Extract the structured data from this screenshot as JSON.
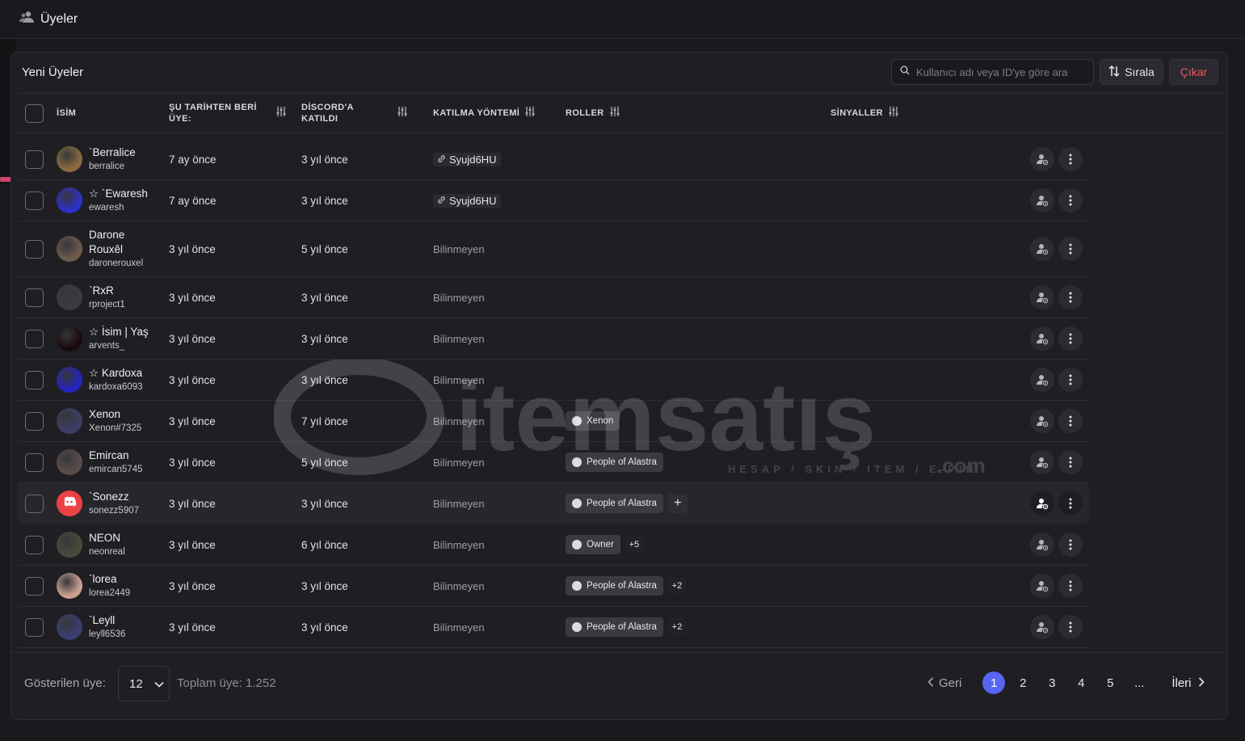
{
  "page": {
    "title": "Üyeler"
  },
  "panel": {
    "title": "Yeni Üyeler",
    "search_placeholder": "Kullanıcı adı veya ID'ye göre ara",
    "sort_label": "Sırala",
    "remove_label": "Çıkar"
  },
  "columns": {
    "name": "İSİM",
    "member_since": "ŞU TARİHTEN BERİ ÜYE:",
    "joined_discord": "DİSCORD'A KATILDI",
    "join_method": "KATILMA YÖNTEMİ",
    "roles": "ROLLER",
    "signals": "SİNYALLER"
  },
  "rows": [
    {
      "name": "`Berralice",
      "username": "berralice",
      "since": "7 ay önce",
      "joined": "3 yıl önce",
      "method": "Syujd6HU",
      "method_is_invite": true,
      "roles": [],
      "more": "",
      "avatar_color": "#8a6a3e"
    },
    {
      "name": "☆ `Ewaresh",
      "username": "ewaresh",
      "since": "7 ay önce",
      "joined": "3 yıl önce",
      "method": "Syujd6HU",
      "method_is_invite": true,
      "roles": [],
      "more": "",
      "avatar_color": "#2d30c8"
    },
    {
      "name": "Darone Rouxêl",
      "username": "daronerouxel",
      "since": "3 yıl önce",
      "joined": "5 yıl önce",
      "method": "Bilinmeyen",
      "method_is_invite": false,
      "roles": [],
      "more": "",
      "avatar_color": "#6d5a4c"
    },
    {
      "name": "`RxR",
      "username": "rproject1",
      "since": "3 yıl önce",
      "joined": "3 yıl önce",
      "method": "Bilinmeyen",
      "method_is_invite": false,
      "roles": [],
      "more": "",
      "avatar_color": "#3c3c40"
    },
    {
      "name": "☆ İsim | Yaş",
      "username": "arvents_",
      "since": "3 yıl önce",
      "joined": "3 yıl önce",
      "method": "Bilinmeyen",
      "method_is_invite": false,
      "roles": [],
      "more": "",
      "avatar_color": "#1b0a0c"
    },
    {
      "name": "☆ Kardoxa",
      "username": "kardoxa6093",
      "since": "3 yıl önce",
      "joined": "3 yıl önce",
      "method": "Bilinmeyen",
      "method_is_invite": false,
      "roles": [],
      "more": "",
      "avatar_color": "#2424c0"
    },
    {
      "name": "Xenon",
      "username": "Xenon#7325",
      "since": "3 yıl önce",
      "joined": "7 yıl önce",
      "method": "Bilinmeyen",
      "method_is_invite": false,
      "roles": [
        "Xenon"
      ],
      "more": "",
      "avatar_color": "#3d3d66"
    },
    {
      "name": "Emircan",
      "username": "emircan5745",
      "since": "3 yıl önce",
      "joined": "5 yıl önce",
      "method": "Bilinmeyen",
      "method_is_invite": false,
      "roles": [
        "People of Alastra"
      ],
      "more": "",
      "avatar_color": "#5a4c4a"
    },
    {
      "name": "`Sonezz",
      "username": "sonezz5907",
      "since": "3 yıl önce",
      "joined": "3 yıl önce",
      "method": "Bilinmeyen",
      "method_is_invite": false,
      "roles": [
        "People of Alastra"
      ],
      "more": "",
      "add_role": "+",
      "avatar_color": "#ed4245",
      "highlight": true
    },
    {
      "name": "NEON",
      "username": "neonreal",
      "since": "3 yıl önce",
      "joined": "6 yıl önce",
      "method": "Bilinmeyen",
      "method_is_invite": false,
      "roles": [
        "Owner"
      ],
      "more": "+5",
      "avatar_color": "#4a4a3a"
    },
    {
      "name": "`lorea",
      "username": "lorea2449",
      "since": "3 yıl önce",
      "joined": "3 yıl önce",
      "method": "Bilinmeyen",
      "method_is_invite": false,
      "roles": [
        "People of Alastra"
      ],
      "more": "+2",
      "avatar_color": "#c9a090"
    },
    {
      "name": "`Leyll",
      "username": "leyll6536",
      "since": "3 yıl önce",
      "joined": "3 yıl önce",
      "method": "Bilinmeyen",
      "method_is_invite": false,
      "roles": [
        "People of Alastra"
      ],
      "more": "+2",
      "avatar_color": "#3a3f70"
    }
  ],
  "footer": {
    "shown_label": "Gösterilen üye:",
    "page_size": "12",
    "total_label": "Toplam üye: 1.252",
    "prev_label": "Geri",
    "next_label": "İleri",
    "pages": [
      "1",
      "2",
      "3",
      "4",
      "5",
      "..."
    ],
    "active_page": "1"
  },
  "watermark": {
    "brand": "itemsatış",
    "tagline": "HESAP / SKIN / ITEM / E-PIN",
    "suffix": ".com"
  },
  "colors": {
    "accent": "#5865f2",
    "danger": "#ef5a5a",
    "background": "#1a1a1e",
    "panel": "#1f1f23"
  },
  "icons": {
    "header": "members-icon",
    "search": "search-icon",
    "sort": "sort-arrows-icon",
    "filter": "sliders-icon",
    "invite": "link-icon",
    "profile": "user-settings-icon",
    "menu": "kebab-menu-icon",
    "chevron": "chevron-down-icon"
  }
}
